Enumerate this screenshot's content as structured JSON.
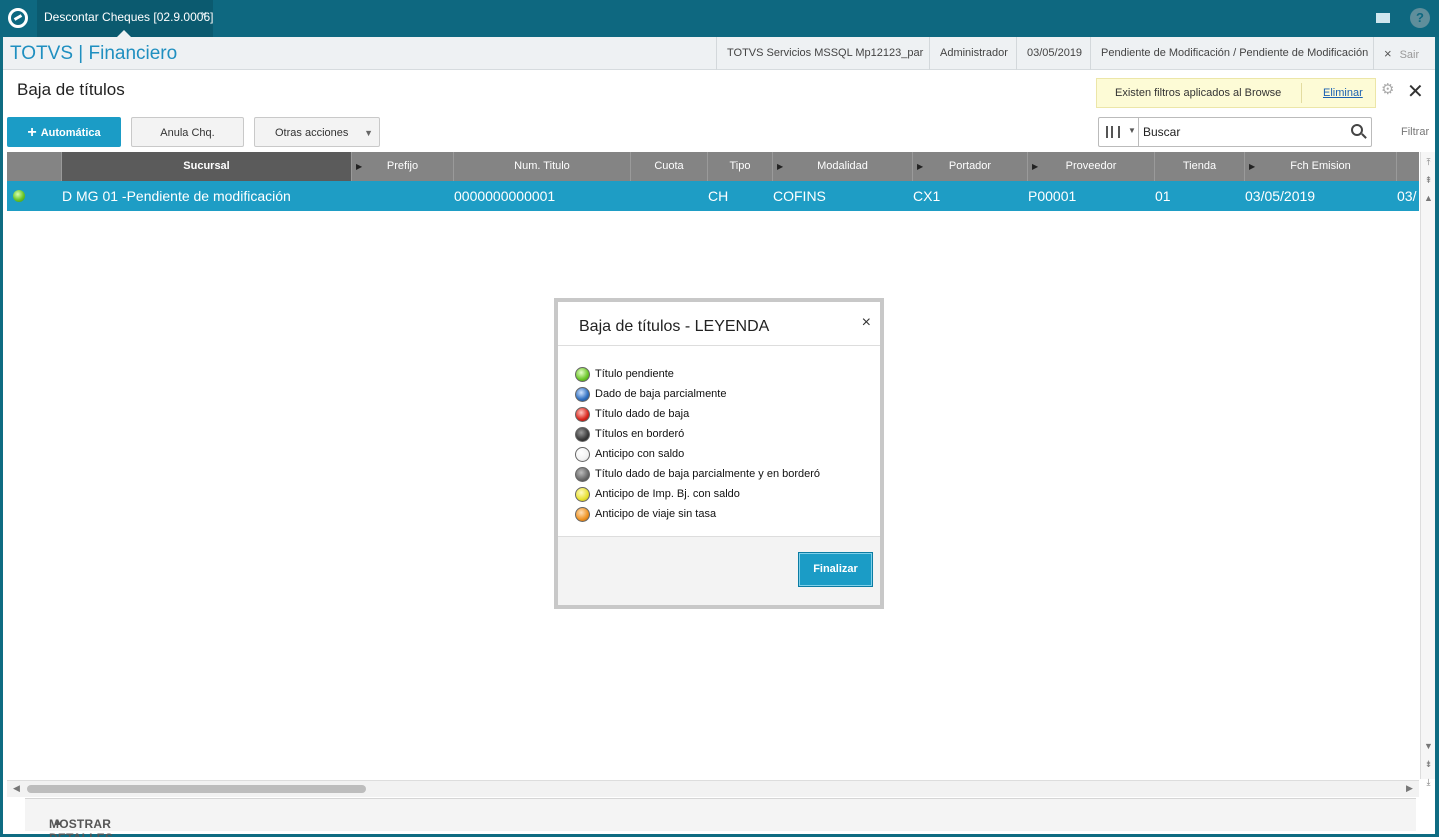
{
  "app_tab": {
    "label": "Descontar Cheques [02.9.0006]",
    "close": "×"
  },
  "header": {
    "brand": "TOTVS | Financiero",
    "environment": "TOTVS Servicios MSSQL Mp12123_par",
    "user": "Administrador",
    "date": "03/05/2019",
    "status": "Pendiente de Modificación / Pendiente de Modificación",
    "exit_label": "Sair",
    "exit_icon": "×"
  },
  "page": {
    "title": "Baja de títulos"
  },
  "filter_notice": {
    "text": "Existen filtros aplicados al Browse",
    "link": "Eliminar"
  },
  "toolbar": {
    "primary_button": {
      "icon": "+",
      "label": "Automática"
    },
    "anula_button": "Anula Chq.",
    "otras_button": "Otras acciones",
    "search_placeholder": "Buscar",
    "search_value": "Buscar",
    "filter_label": "Filtrar"
  },
  "grid": {
    "columns": [
      "Sucursal",
      "Prefijo",
      "Num. Titulo",
      "Cuota",
      "Tipo",
      "Modalidad",
      "Portador",
      "Proveedor",
      "Tienda",
      "Fch Emision"
    ],
    "rows": [
      {
        "status": "Título pendiente",
        "sucursal": "D MG 01 -Pendiente de modificación",
        "prefijo": "",
        "num_titulo": "0000000000001",
        "cuota": "",
        "tipo": "CH",
        "modalidad": "COFINS",
        "portador": "CX1",
        "proveedor": "P00001",
        "tienda": "01",
        "fch_emision": "03/05/2019",
        "overflow": "03/"
      }
    ]
  },
  "footer": {
    "label": "MOSTRAR DETALLES",
    "icon": "▲"
  },
  "legend_modal": {
    "title": "Baja de títulos - LEYENDA",
    "close": "×",
    "items": [
      {
        "label": "Título pendiente",
        "color": "#6ac526"
      },
      {
        "label": "Dado de baja parcialmente",
        "color": "#2f6fc0"
      },
      {
        "label": "Título dado de baja",
        "color": "#d9261c"
      },
      {
        "label": "Títulos en borderó",
        "color": "#3c3c3c"
      },
      {
        "label": "Anticipo con saldo",
        "color": "#f2f2f2"
      },
      {
        "label": "Título dado de baja parcialmente y en borderó",
        "color": "#6b6b6b"
      },
      {
        "label": "Anticipo de Imp. Bj. con saldo",
        "color": "#e8e030"
      },
      {
        "label": "Anticipo de viaje sin tasa",
        "color": "#ef9322"
      }
    ],
    "button": "Finalizar"
  }
}
